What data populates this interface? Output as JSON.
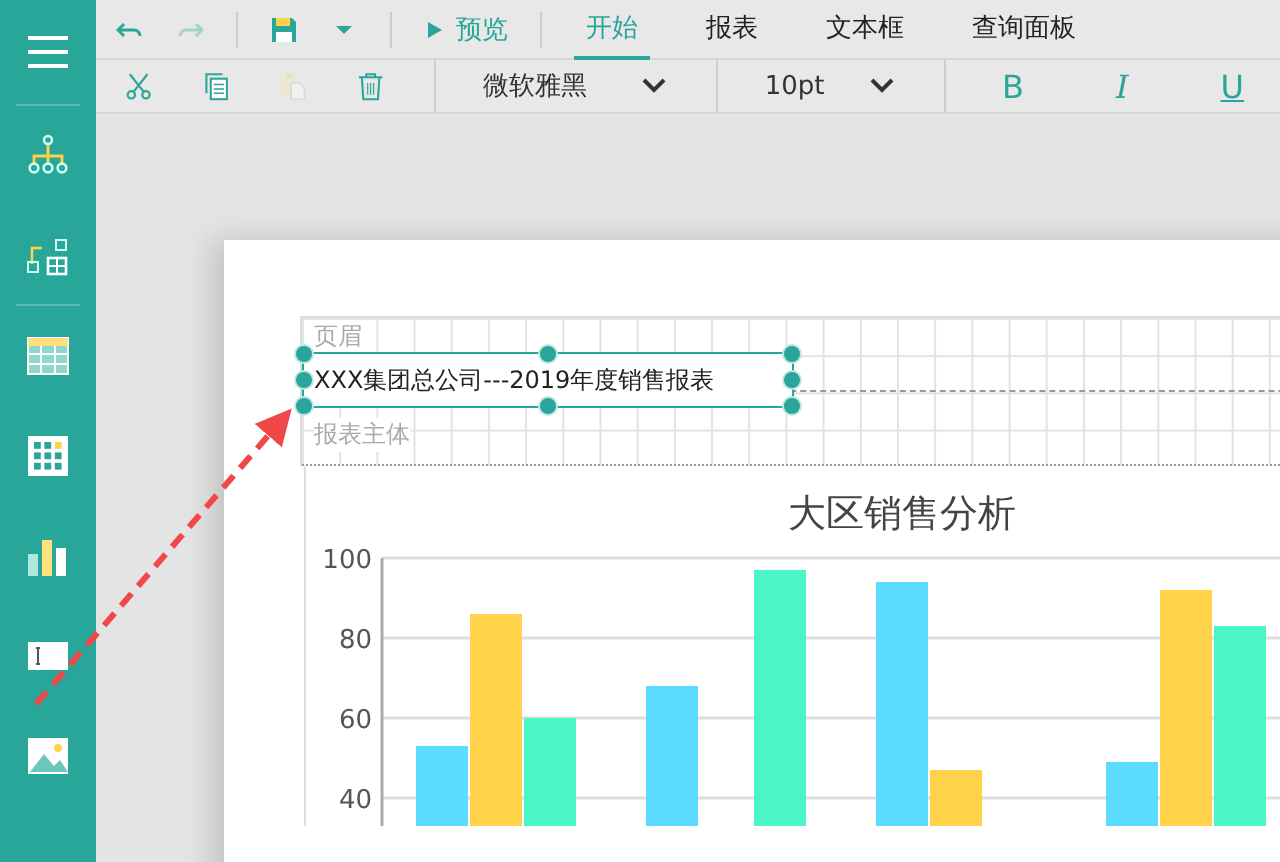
{
  "quick_access": {
    "items": [
      {
        "kind": "undo",
        "disabled": false
      },
      {
        "kind": "redo",
        "disabled": true
      },
      {
        "kind": "save",
        "disabled": false
      },
      {
        "kind": "dropdown",
        "disabled": false
      }
    ],
    "preview": "预览"
  },
  "tabs": [
    {
      "label": "开始",
      "selected": true
    },
    {
      "label": "报表",
      "selected": false
    },
    {
      "label": "文本框",
      "selected": false
    },
    {
      "label": "查询面板",
      "selected": false
    }
  ],
  "toolbar": {
    "actions": [
      {
        "kind": "cut",
        "disabled": false
      },
      {
        "kind": "copy",
        "disabled": false
      },
      {
        "kind": "paste",
        "disabled": true
      },
      {
        "kind": "delete",
        "disabled": false
      }
    ],
    "font": "微软雅黑",
    "size": "10pt",
    "format": [
      {
        "kind": "bold",
        "label": "B"
      },
      {
        "kind": "italic",
        "label": "I"
      },
      {
        "kind": "underline",
        "label": "U"
      }
    ]
  },
  "sidebar": {
    "items": [
      {
        "kind": "menu"
      },
      {
        "kind": "tree"
      },
      {
        "kind": "add-grid"
      },
      {
        "kind": "table"
      },
      {
        "kind": "matrix"
      },
      {
        "kind": "chart"
      },
      {
        "kind": "textbox"
      },
      {
        "kind": "image"
      }
    ]
  },
  "designer": {
    "sections": [
      {
        "label": "页眉"
      },
      {
        "label": "报表主体"
      }
    ],
    "textbox": {
      "text": "XXX集团总公司---2019年度销售报表",
      "selected": true
    },
    "chart": {
      "chart_data": {
        "type": "bar",
        "title": "大区销售分析",
        "ylim": [
          40,
          100
        ],
        "yticks": [
          40,
          60,
          80,
          100
        ],
        "series": [
          {
            "color": "#5cdcff",
            "values": [
              53,
              68,
              94,
              49
            ]
          },
          {
            "color": "#ffd24a",
            "values": [
              86,
              null,
              47,
              92
            ]
          },
          {
            "color": "#4af5c8",
            "values": [
              60,
              97,
              null,
              83
            ]
          }
        ]
      }
    }
  }
}
